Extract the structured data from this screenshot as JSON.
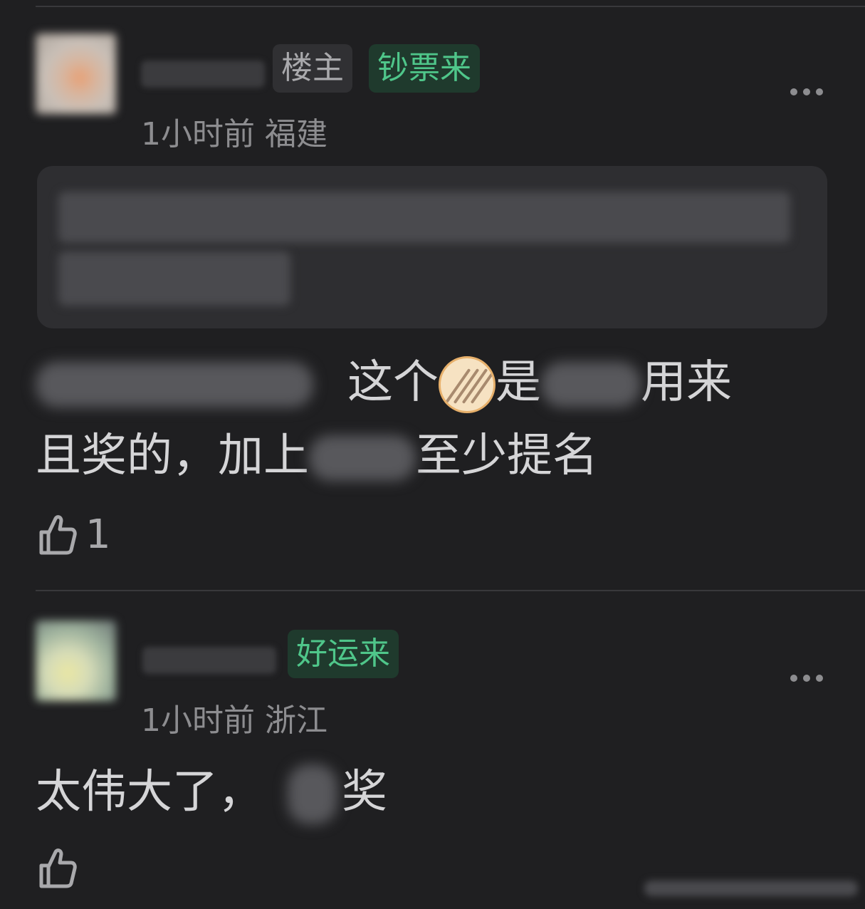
{
  "comments": [
    {
      "badges": [
        "楼主",
        "钞票来"
      ],
      "time": "1小时前",
      "location": "福建",
      "line1_a": "这个",
      "line1_b": "是",
      "line1_c": "用来",
      "line2_a": "且奖的，加上",
      "line2_b": "至少提名",
      "likes": "1",
      "emoji": "medal-emoji"
    },
    {
      "badge": "好运来",
      "time": "1小时前",
      "location": "浙江",
      "line1_a": "太伟大了，",
      "line1_b": "奖",
      "likes": ""
    }
  ],
  "colors": {
    "background": "#1f1f21",
    "badge_green_text": "#4fc68a",
    "badge_green_bg": "#1f3a2d",
    "meta_text": "#8d8d90"
  }
}
